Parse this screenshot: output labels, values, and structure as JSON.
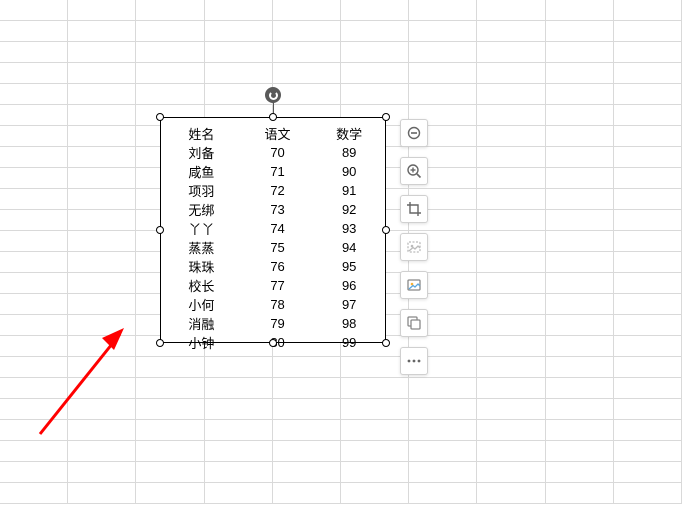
{
  "table": {
    "headers": [
      "姓名",
      "语文",
      "数学"
    ],
    "rows": [
      [
        "刘备",
        "70",
        "89"
      ],
      [
        "咸鱼",
        "71",
        "90"
      ],
      [
        "项羽",
        "72",
        "91"
      ],
      [
        "无绑",
        "73",
        "92"
      ],
      [
        "丫丫",
        "74",
        "93"
      ],
      [
        "蒸蒸",
        "75",
        "94"
      ],
      [
        "珠珠",
        "76",
        "95"
      ],
      [
        "校长",
        "77",
        "96"
      ],
      [
        "小何",
        "78",
        "97"
      ],
      [
        "消融",
        "79",
        "98"
      ],
      [
        "小钟",
        "80",
        "99"
      ]
    ]
  },
  "toolbar": {
    "minus": "minus-icon",
    "zoom": "magnifier-plus-icon",
    "crop": "crop-icon",
    "replace": "replace-image-icon",
    "export": "export-image-icon",
    "send": "send-image-icon",
    "more": "more-icon"
  },
  "meta": {
    "sheet_rows": 24,
    "sheet_cols": 10
  }
}
